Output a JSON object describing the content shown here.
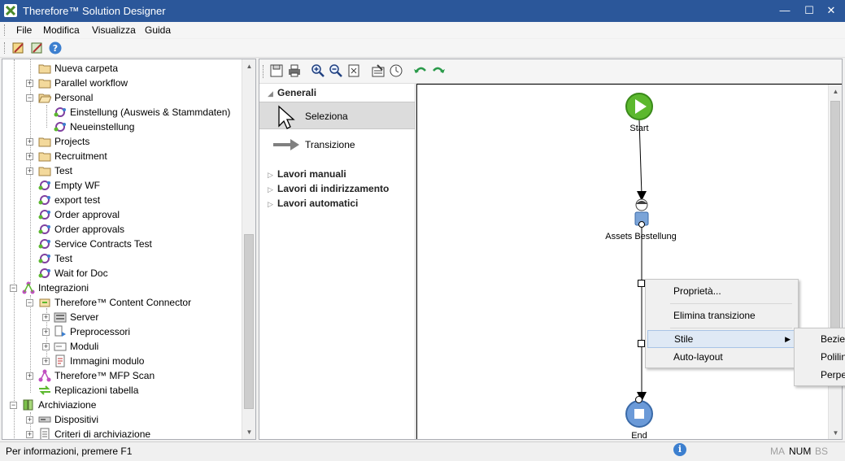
{
  "window": {
    "title": "Therefore™ Solution Designer",
    "minimize": "—",
    "maximize": "☐",
    "close": "✕"
  },
  "menu": [
    "File",
    "Modifica",
    "Visualizza",
    "Guida"
  ],
  "tree": {
    "items": [
      {
        "label": "Nueva carpeta",
        "icon": "folder-icon"
      },
      {
        "label": "Parallel workflow",
        "icon": "folder-icon"
      },
      {
        "label": "Personal",
        "icon": "folder-open-icon"
      },
      {
        "label": "Einstellung (Ausweis & Stammdaten)",
        "icon": "workflow-icon"
      },
      {
        "label": "Neueinstellung",
        "icon": "workflow-icon"
      },
      {
        "label": "Projects",
        "icon": "folder-icon"
      },
      {
        "label": "Recruitment",
        "icon": "folder-icon"
      },
      {
        "label": "Test",
        "icon": "folder-icon"
      },
      {
        "label": "Empty WF",
        "icon": "workflow-icon"
      },
      {
        "label": "export test",
        "icon": "workflow-icon"
      },
      {
        "label": "Order approval",
        "icon": "workflow-icon"
      },
      {
        "label": "Order approvals",
        "icon": "workflow-icon"
      },
      {
        "label": "Service Contracts Test",
        "icon": "workflow-icon"
      },
      {
        "label": "Test",
        "icon": "workflow-icon"
      },
      {
        "label": "Wait for Doc",
        "icon": "workflow-icon"
      },
      {
        "label": "Integrazioni",
        "icon": "integration-icon"
      },
      {
        "label": "Therefore™ Content Connector",
        "icon": "connector-icon"
      },
      {
        "label": "Server",
        "icon": "server-icon"
      },
      {
        "label": "Preprocessori",
        "icon": "preprocessor-icon"
      },
      {
        "label": "Moduli",
        "icon": "form-icon"
      },
      {
        "label": "Immagini modulo",
        "icon": "form-image-icon"
      },
      {
        "label": "Therefore™ MFP Scan",
        "icon": "integration-icon"
      },
      {
        "label": "Replicazioni tabella",
        "icon": "replication-icon"
      },
      {
        "label": "Archiviazione",
        "icon": "archive-icon"
      },
      {
        "label": "Dispositivi",
        "icon": "device-icon"
      },
      {
        "label": "Criteri di archiviazione",
        "icon": "archive-policy-icon"
      }
    ]
  },
  "palette": {
    "general": "Generali",
    "select": "Seleziona",
    "transition": "Transizione",
    "manual_tasks": "Lavori manuali",
    "routing_tasks": "Lavori di indirizzamento",
    "automatic_tasks": "Lavori automatici"
  },
  "canvas": {
    "start_label": "Start",
    "task_label": "Assets Bestellung",
    "end_label": "End"
  },
  "context_menu": {
    "properties": "Proprietà...",
    "delete_transition": "Elimina transizione",
    "style": "Stile",
    "auto_layout": "Auto-layout"
  },
  "submenu": {
    "bezier": "Bezier",
    "polyline": "Polilinea",
    "perpendicular": "Perpendicolare"
  },
  "status": {
    "message": "Per informazioni, premere F1",
    "ma": "MA",
    "num": "NUM",
    "bs": "BS"
  },
  "colors": {
    "titlebar": "#2b579a",
    "start_green": "#5cb82e",
    "end_blue": "#6b9ad8"
  }
}
